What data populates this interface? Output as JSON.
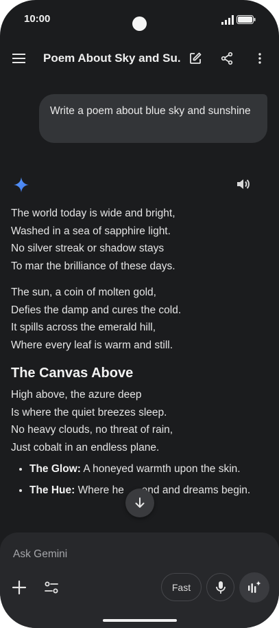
{
  "status": {
    "time": "10:00"
  },
  "topbar": {
    "title": "Poem About Sky and Su..."
  },
  "user_message": "Write a poem about blue sky and sunshine",
  "response": {
    "stanza1": [
      "The world today is wide and bright,",
      "Washed in a sea of sapphire light.",
      "No silver streak or shadow stays",
      "To mar the brilliance of these days."
    ],
    "stanza2": [
      "The sun, a coin of molten gold,",
      "Defies the damp and cures the cold.",
      "It spills across the emerald hill,",
      "Where every leaf is warm and still."
    ],
    "heading": "The Canvas Above",
    "stanza3": [
      "High above, the azure deep",
      "Is where the quiet breezes sleep.",
      "No heavy clouds, no threat of rain,",
      "Just cobalt in an endless plane."
    ],
    "bullets": [
      {
        "term": "The Glow:",
        "text": " A honeyed warmth upon the skin."
      },
      {
        "term": "The Hue:",
        "text": " Where he      end and dreams begin."
      }
    ]
  },
  "composer": {
    "placeholder": "Ask Gemini",
    "fast_label": "Fast"
  },
  "colors": {
    "background": "#1b1c1e",
    "bubble": "#333538",
    "composer": "#27282b",
    "gemini_blue": "#4a8df8"
  }
}
